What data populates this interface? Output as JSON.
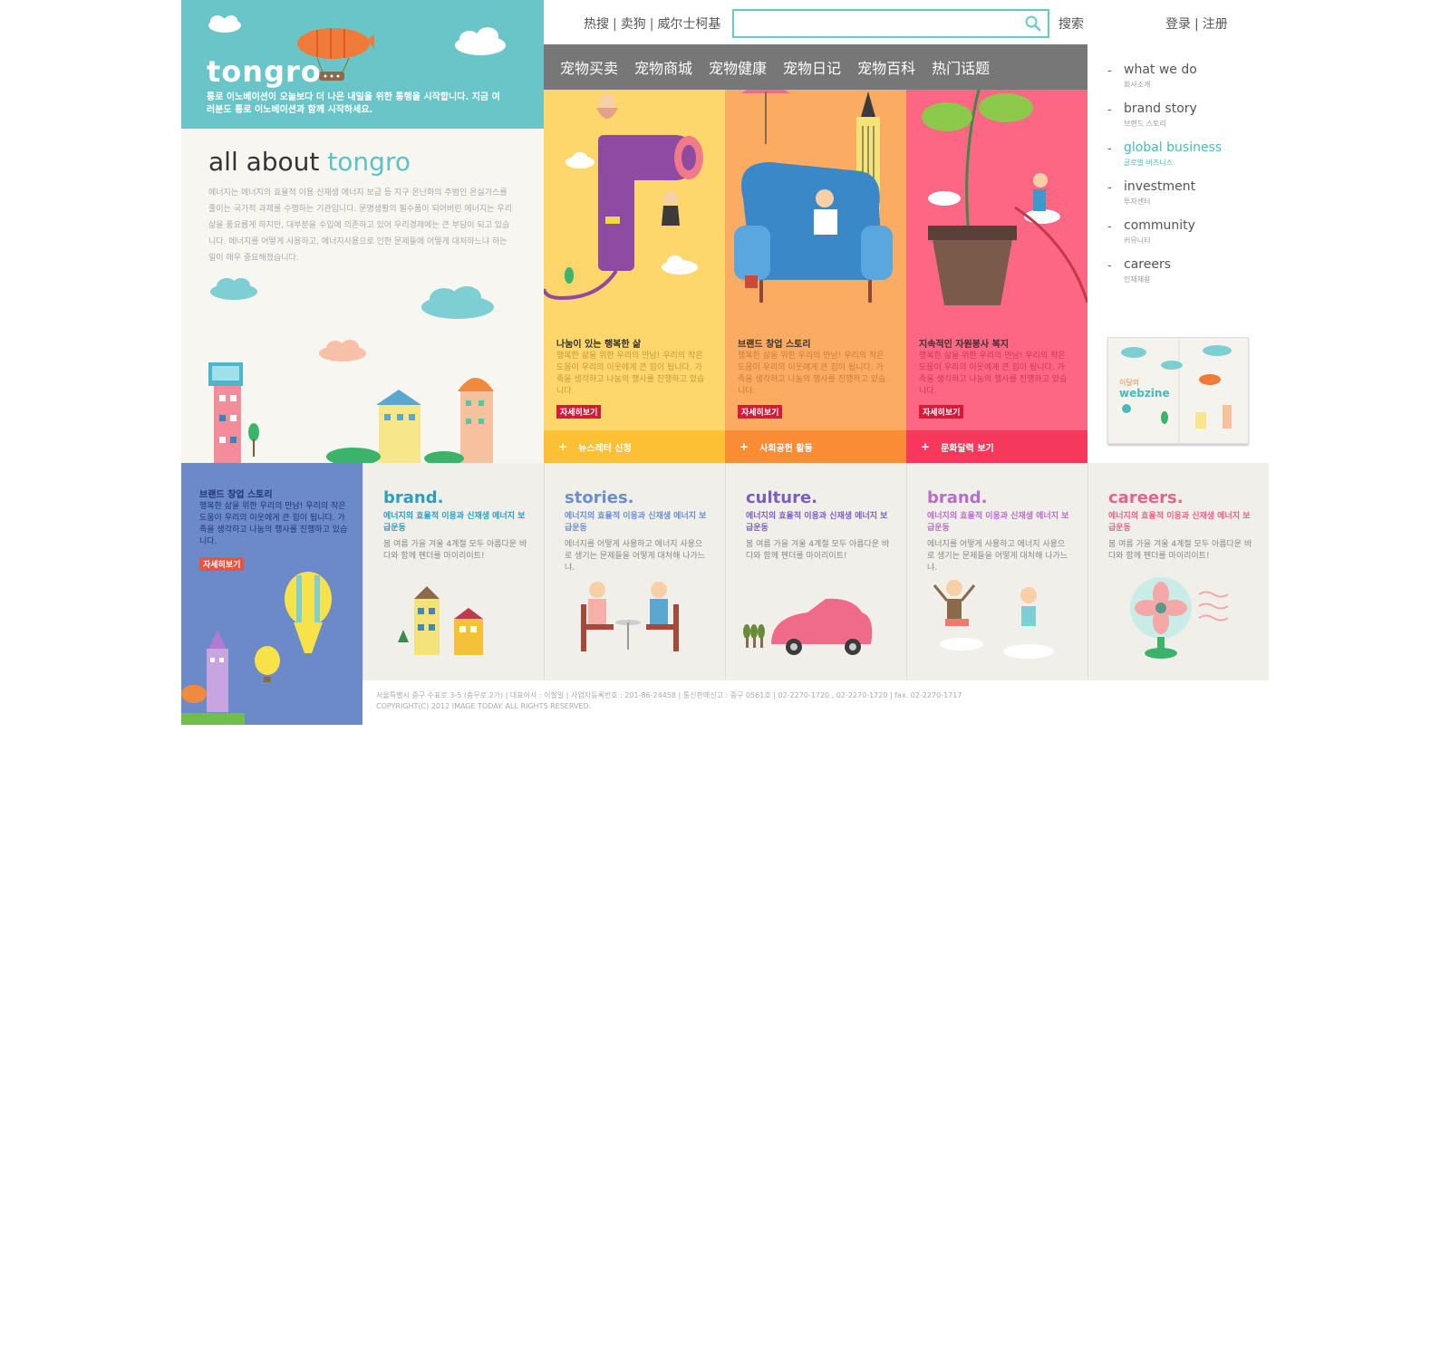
{
  "header": {
    "hot_links": [
      "热搜",
      "卖狗",
      "威尔士柯基"
    ],
    "search": {
      "value": "",
      "placeholder": ""
    },
    "search_button": "搜索",
    "auth": {
      "login": "登录",
      "register": "注册"
    }
  },
  "hero": {
    "brand": "tongro",
    "tagline": "통로 이노베이션이 오늘보다 더 나은 내일을 위한 통행을 시작합니다. 지금 여러분도 통로 이노베이션과 함께 시작하세요.",
    "about_title_1": "all about",
    "about_title_2": "tongro",
    "about_text": "에너지는 에너지의 효율적 이용 신재생 에너지 보급 등 지구 온난화의 주범인 온실가스를 줄이는 국가적 과제를 수행하는 기관입니다. 문명생활의 필수품이 되어버린 에너지는 우리 삶을 풍요롭게 하지만, 대부분을 수입에 의존하고 있어 우리경제에는 큰 부담이 되고 있습니다. 에너지를 어떻게 사용하고, 에너지사용으로 인한 문제들에 어떻게 대처하느냐 하는 일이 매우 중요해졌습니다."
  },
  "nav": {
    "items": [
      "宠物买卖",
      "宠物商城",
      "宠物健康",
      "宠物日记",
      "宠物百科",
      "热门话题"
    ]
  },
  "panels": [
    {
      "title": "나눔이 있는 행복한 삶",
      "desc": "행복한 삶을 위한 우리의 만남! 우리의 작은 도움이 우리의 이웃에게 큰 힘이 됩니다. 가족을 생각하고 나눔의 행사를 진행하고 있습니다.",
      "more": "자세히보기",
      "footer": "뉴스레터 신청"
    },
    {
      "title": "브랜드 창업 스토리",
      "desc": "행복한 삶을 위한 우리의 만남! 우리의 작은 도움이 우리의 이웃에게 큰 힘이 됩니다. 가족을 생각하고 나눔의 행사를 진행하고 있습니다.",
      "more": "자세히보기",
      "footer": "사회공헌 활동"
    },
    {
      "title": "지속적인 자원봉사 복지",
      "desc": "행복한 삶을 위한 우리의 만남! 우리의 작은 도움이 우리의 이웃에게 큰 힘이 됩니다. 가족을 생각하고 나눔의 행사를 진행하고 있습니다.",
      "more": "자세히보기",
      "footer": "문화달력 보기"
    }
  ],
  "sidebar": {
    "items": [
      {
        "en": "what we do",
        "ko": "회사소개"
      },
      {
        "en": "brand story",
        "ko": "브랜드 스토리"
      },
      {
        "en": "global business",
        "ko": "글로벌 비즈니스"
      },
      {
        "en": "investment",
        "ko": "투자센터"
      },
      {
        "en": "community",
        "ko": "커뮤니티"
      },
      {
        "en": "careers",
        "ko": "인재채용"
      }
    ],
    "webzine_small": "이달의",
    "webzine": "webzine"
  },
  "feature": {
    "title": "브랜드 창업 스토리",
    "desc": "행복한 삶을 위한 우리의 만남! 우리의 작은 도움이 우리의 이웃에게 큰 힘이 됩니다. 가족을 생각하고 나눔의 행사를 진행하고 있습니다.",
    "more": "자세히보기"
  },
  "cards": [
    {
      "title": "brand.",
      "sub": "에너지의 효율적 이용과 신재생 에너지 보급운동",
      "desc": "봄 여름 가을 겨울 4계절 모두 아름다운 바다와 함께 펜더를 마이리이트!"
    },
    {
      "title": "stories.",
      "sub": "에너지의 효율적 이용과 신재생 에너지 보급운동",
      "desc": "에너지를 어떻게 사용하고 에너지 사용으로 생기는 문제들을 어떻게 대처해 나가느냐."
    },
    {
      "title": "culture.",
      "sub": "에너지의 효율적 이용과 신재생 에너지 보급운동",
      "desc": "봄 여름 가을 겨울 4계절 모두 아름다운 바다와 함께 펜더를 마이리이트!"
    },
    {
      "title": "brand.",
      "sub": "에너지의 효율적 이용과 신재생 에너지 보급운동",
      "desc": "에너지를 어떻게 사용하고 에너지 사용으로 생기는 문제들을 어떻게 대처해 나가느냐."
    },
    {
      "title": "careers.",
      "sub": "에너지의 효율적 이용과 신재생 에너지 보급운동",
      "desc": "봄 여름 가을 겨울 4계절 모두 아름다운 바다와 함께 펜더를 마이리이트!"
    }
  ],
  "footer": {
    "line1": "서울특별시 중구 수표로 3-5 (충무로 2가)  |  대표이사 : 이철일  |  사업자등록번호 : 201-86-24458  |  통신판매신고 : 중구 0561호  |  02-2270-1720 , 02-2270-1720  |  fax. 02-2270-1717",
    "line2": "COPYRIGHT(C) 2012 IMAGE TODAY. ALL RIGHTS RESERVED."
  },
  "colors": {
    "teal": "#69c5c7",
    "nav_gray": "#777777",
    "yellow": "#fdd66c",
    "orange": "#fcac62",
    "pink": "#fd6783",
    "blue": "#6c89c9"
  }
}
